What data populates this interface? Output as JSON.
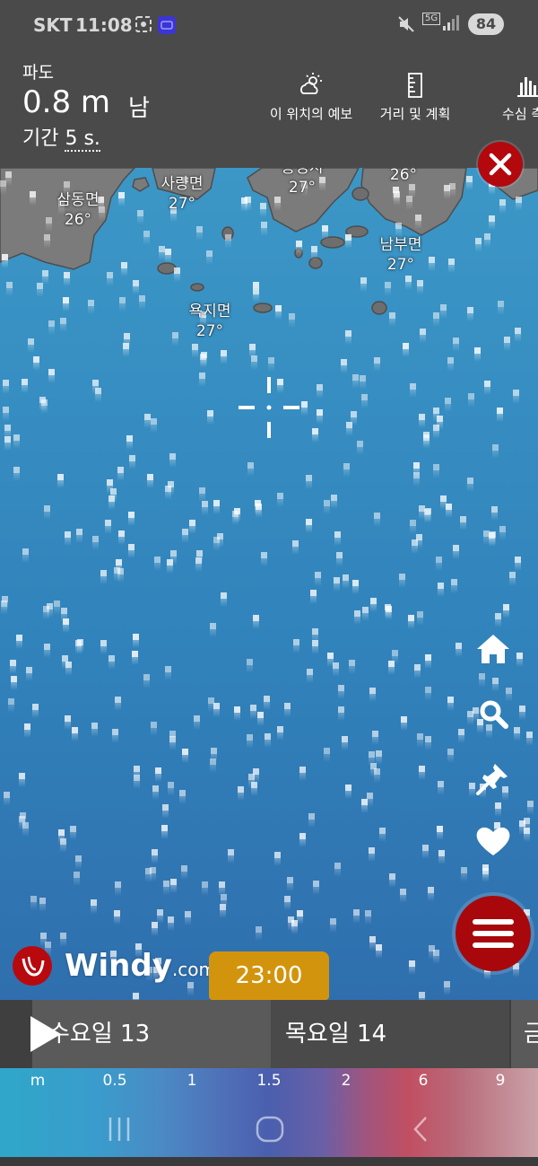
{
  "status_bar": {
    "carrier": "SKT",
    "time": "11:08",
    "network": "5G",
    "battery": "84"
  },
  "header": {
    "layer_name": "파도",
    "value": "0.8 m",
    "direction": "남",
    "period_label": "기간",
    "period_value": "5 s."
  },
  "header_buttons": [
    {
      "label": "이 위치의 예보",
      "icon": "cloud-sun-icon"
    },
    {
      "label": "거리 및 계획",
      "icon": "ruler-icon"
    },
    {
      "label": "수심 측정",
      "icon": "bar-chart-icon"
    }
  ],
  "map": {
    "places": [
      {
        "name": "삼동면",
        "temp": "26°"
      },
      {
        "name": "사량면",
        "temp": "27°"
      },
      {
        "name": "통영시",
        "temp": "27°"
      },
      {
        "name": "",
        "temp": "26°"
      },
      {
        "name": "남부면",
        "temp": "27°"
      },
      {
        "name": "욕지면",
        "temp": "27°"
      }
    ]
  },
  "tools": [
    "home-icon",
    "search-icon",
    "pin-icon",
    "heart-icon",
    "menu-icon"
  ],
  "logo": {
    "brand": "Windy",
    "domain": ".com"
  },
  "timeline": {
    "current_time": "23:00",
    "days": [
      "수요일 13",
      "목요일 14",
      "금"
    ]
  },
  "legend": {
    "unit": "m",
    "values": [
      "0.5",
      "1",
      "1.5",
      "2",
      "6",
      "9"
    ]
  },
  "colors": {
    "accent_red": "#b3080e",
    "time_bubble": "#d3940d",
    "header_bg": "#4a4a4a"
  }
}
